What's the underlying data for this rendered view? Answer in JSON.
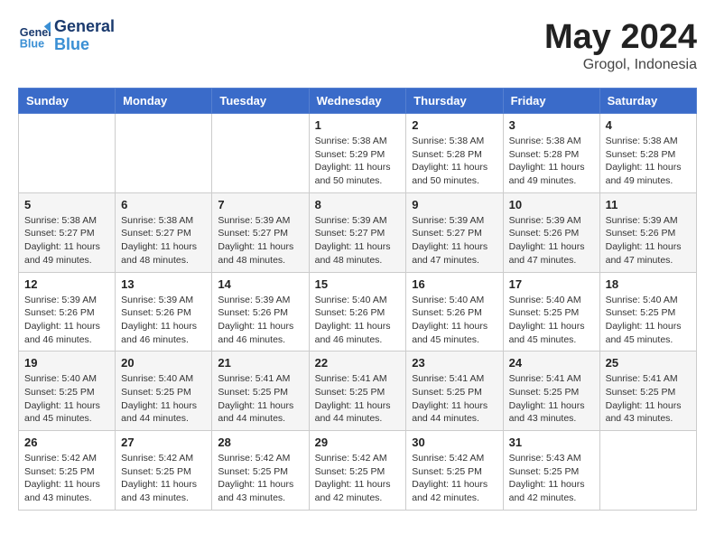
{
  "header": {
    "logo_text_general": "General",
    "logo_text_blue": "Blue",
    "month_year": "May 2024",
    "location": "Grogol, Indonesia"
  },
  "weekdays": [
    "Sunday",
    "Monday",
    "Tuesday",
    "Wednesday",
    "Thursday",
    "Friday",
    "Saturday"
  ],
  "weeks": [
    [
      {
        "day": "",
        "info": ""
      },
      {
        "day": "",
        "info": ""
      },
      {
        "day": "",
        "info": ""
      },
      {
        "day": "1",
        "info": "Sunrise: 5:38 AM\nSunset: 5:29 PM\nDaylight: 11 hours\nand 50 minutes."
      },
      {
        "day": "2",
        "info": "Sunrise: 5:38 AM\nSunset: 5:28 PM\nDaylight: 11 hours\nand 50 minutes."
      },
      {
        "day": "3",
        "info": "Sunrise: 5:38 AM\nSunset: 5:28 PM\nDaylight: 11 hours\nand 49 minutes."
      },
      {
        "day": "4",
        "info": "Sunrise: 5:38 AM\nSunset: 5:28 PM\nDaylight: 11 hours\nand 49 minutes."
      }
    ],
    [
      {
        "day": "5",
        "info": "Sunrise: 5:38 AM\nSunset: 5:27 PM\nDaylight: 11 hours\nand 49 minutes."
      },
      {
        "day": "6",
        "info": "Sunrise: 5:38 AM\nSunset: 5:27 PM\nDaylight: 11 hours\nand 48 minutes."
      },
      {
        "day": "7",
        "info": "Sunrise: 5:39 AM\nSunset: 5:27 PM\nDaylight: 11 hours\nand 48 minutes."
      },
      {
        "day": "8",
        "info": "Sunrise: 5:39 AM\nSunset: 5:27 PM\nDaylight: 11 hours\nand 48 minutes."
      },
      {
        "day": "9",
        "info": "Sunrise: 5:39 AM\nSunset: 5:27 PM\nDaylight: 11 hours\nand 47 minutes."
      },
      {
        "day": "10",
        "info": "Sunrise: 5:39 AM\nSunset: 5:26 PM\nDaylight: 11 hours\nand 47 minutes."
      },
      {
        "day": "11",
        "info": "Sunrise: 5:39 AM\nSunset: 5:26 PM\nDaylight: 11 hours\nand 47 minutes."
      }
    ],
    [
      {
        "day": "12",
        "info": "Sunrise: 5:39 AM\nSunset: 5:26 PM\nDaylight: 11 hours\nand 46 minutes."
      },
      {
        "day": "13",
        "info": "Sunrise: 5:39 AM\nSunset: 5:26 PM\nDaylight: 11 hours\nand 46 minutes."
      },
      {
        "day": "14",
        "info": "Sunrise: 5:39 AM\nSunset: 5:26 PM\nDaylight: 11 hours\nand 46 minutes."
      },
      {
        "day": "15",
        "info": "Sunrise: 5:40 AM\nSunset: 5:26 PM\nDaylight: 11 hours\nand 46 minutes."
      },
      {
        "day": "16",
        "info": "Sunrise: 5:40 AM\nSunset: 5:26 PM\nDaylight: 11 hours\nand 45 minutes."
      },
      {
        "day": "17",
        "info": "Sunrise: 5:40 AM\nSunset: 5:25 PM\nDaylight: 11 hours\nand 45 minutes."
      },
      {
        "day": "18",
        "info": "Sunrise: 5:40 AM\nSunset: 5:25 PM\nDaylight: 11 hours\nand 45 minutes."
      }
    ],
    [
      {
        "day": "19",
        "info": "Sunrise: 5:40 AM\nSunset: 5:25 PM\nDaylight: 11 hours\nand 45 minutes."
      },
      {
        "day": "20",
        "info": "Sunrise: 5:40 AM\nSunset: 5:25 PM\nDaylight: 11 hours\nand 44 minutes."
      },
      {
        "day": "21",
        "info": "Sunrise: 5:41 AM\nSunset: 5:25 PM\nDaylight: 11 hours\nand 44 minutes."
      },
      {
        "day": "22",
        "info": "Sunrise: 5:41 AM\nSunset: 5:25 PM\nDaylight: 11 hours\nand 44 minutes."
      },
      {
        "day": "23",
        "info": "Sunrise: 5:41 AM\nSunset: 5:25 PM\nDaylight: 11 hours\nand 44 minutes."
      },
      {
        "day": "24",
        "info": "Sunrise: 5:41 AM\nSunset: 5:25 PM\nDaylight: 11 hours\nand 43 minutes."
      },
      {
        "day": "25",
        "info": "Sunrise: 5:41 AM\nSunset: 5:25 PM\nDaylight: 11 hours\nand 43 minutes."
      }
    ],
    [
      {
        "day": "26",
        "info": "Sunrise: 5:42 AM\nSunset: 5:25 PM\nDaylight: 11 hours\nand 43 minutes."
      },
      {
        "day": "27",
        "info": "Sunrise: 5:42 AM\nSunset: 5:25 PM\nDaylight: 11 hours\nand 43 minutes."
      },
      {
        "day": "28",
        "info": "Sunrise: 5:42 AM\nSunset: 5:25 PM\nDaylight: 11 hours\nand 43 minutes."
      },
      {
        "day": "29",
        "info": "Sunrise: 5:42 AM\nSunset: 5:25 PM\nDaylight: 11 hours\nand 42 minutes."
      },
      {
        "day": "30",
        "info": "Sunrise: 5:42 AM\nSunset: 5:25 PM\nDaylight: 11 hours\nand 42 minutes."
      },
      {
        "day": "31",
        "info": "Sunrise: 5:43 AM\nSunset: 5:25 PM\nDaylight: 11 hours\nand 42 minutes."
      },
      {
        "day": "",
        "info": ""
      }
    ]
  ]
}
